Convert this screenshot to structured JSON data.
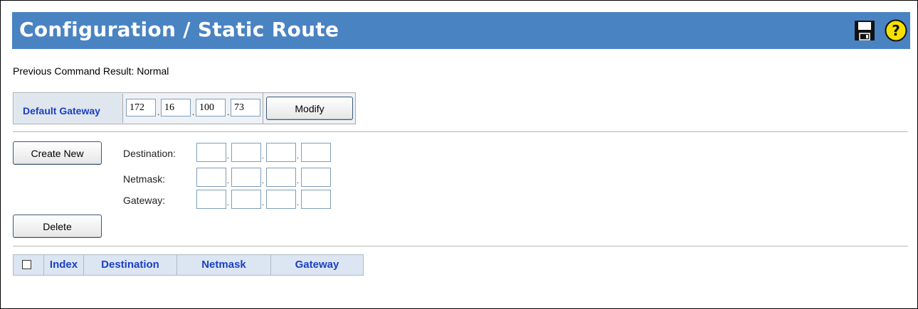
{
  "header": {
    "title": "Configuration / Static Route",
    "save_icon": "floppy-disk-icon",
    "help_icon": "question-mark-icon"
  },
  "status": {
    "previous_command_result": "Previous Command Result: Normal"
  },
  "default_gateway": {
    "label": "Default Gateway",
    "octets": [
      "172",
      "16",
      "100",
      "73"
    ],
    "modify_label": "Modify"
  },
  "route_form": {
    "create_label": "Create New",
    "delete_label": "Delete",
    "destination_label": "Destination:",
    "netmask_label": "Netmask:",
    "gateway_label": "Gateway:"
  },
  "table": {
    "columns": [
      "Index",
      "Destination",
      "Netmask",
      "Gateway"
    ],
    "rows": []
  },
  "colors": {
    "header_bg": "#4a83c2",
    "header_text": "#ffffff",
    "table_header_text": "#1a3fc5",
    "table_header_bg": "#dce6f2"
  }
}
